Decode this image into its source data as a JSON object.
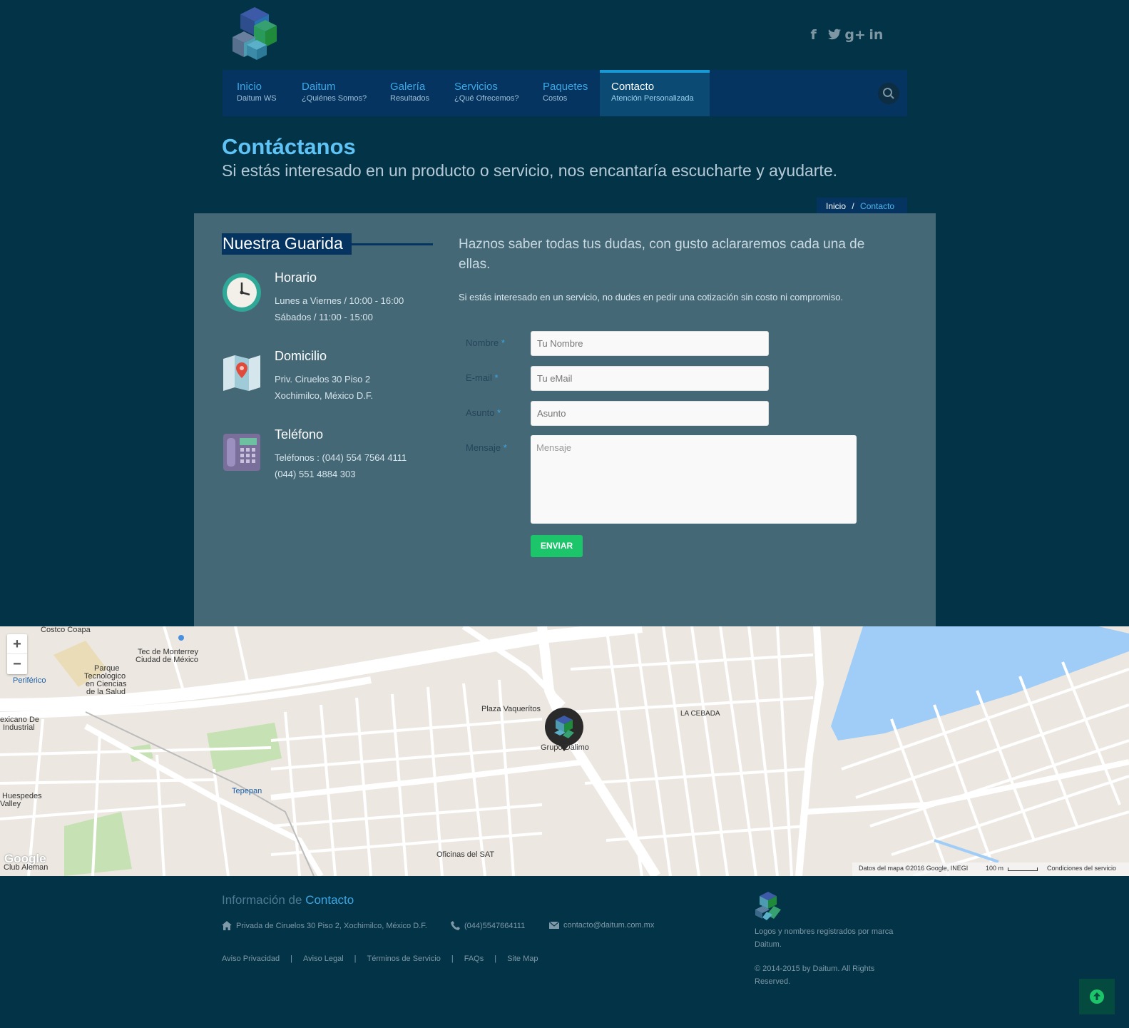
{
  "social": {
    "facebook": "f",
    "twitter": "t",
    "google": "g+",
    "linkedin": "in"
  },
  "nav": [
    {
      "title": "Inicio",
      "sub": "Daitum WS"
    },
    {
      "title": "Daitum",
      "sub": "¿Quiénes Somos?"
    },
    {
      "title": "Galería",
      "sub": "Resultados"
    },
    {
      "title": "Servicios",
      "sub": "¿Qué Ofrecemos?"
    },
    {
      "title": "Paquetes",
      "sub": "Costos"
    },
    {
      "title": "Contacto",
      "sub": "Atención Personalizada"
    }
  ],
  "page": {
    "title": "Contáctanos",
    "subtitle": "Si estás interesado en un producto o servicio, nos encantaría escucharte y ayudarte."
  },
  "breadcrumb": {
    "home": "Inicio",
    "sep": "/",
    "current": "Contacto"
  },
  "guarida": {
    "title": "Nuestra Guarida"
  },
  "info": {
    "horario": {
      "title": "Horario",
      "line1": "Lunes a Viernes / 10:00 - 16:00",
      "line2": "Sábados / 11:00 - 15:00"
    },
    "domicilio": {
      "title": "Domicilio",
      "line1": "Priv. Ciruelos 30 Piso 2",
      "line2": "Xochimilco, México D.F."
    },
    "telefono": {
      "title": "Teléfono",
      "line1": "Teléfonos : (044) 554 7564 4111",
      "line2": "(044) 551 4884 303"
    }
  },
  "form": {
    "lead": "Haznos saber todas tus dudas, con gusto aclararemos cada una de ellas.",
    "lead2": "Si estás interesado en un servicio, no dudes en pedir una cotización sin costo ni compromiso.",
    "required_mark": "*",
    "nombre": {
      "label": "Nombre",
      "placeholder": "Tu Nombre"
    },
    "email": {
      "label": "E-mail",
      "placeholder": "Tu eMail"
    },
    "asunto": {
      "label": "Asunto",
      "placeholder": "Asunto"
    },
    "mensaje": {
      "label": "Mensaje",
      "placeholder": "Mensaje"
    },
    "submit": "ENVIAR"
  },
  "map": {
    "zoom_in": "+",
    "zoom_out": "−",
    "labels": {
      "costco": "Costco Coapa",
      "tec": "Tec de Monterrey",
      "tec2": "Ciudad de México",
      "parque": "Parque",
      "parque2": "Tecnologico",
      "parque3": "en Ciencias",
      "parque4": "de la Salud",
      "periferico": "Periférico",
      "mexicano": "exicano De",
      "mexicano2": "Industrial",
      "huespedes": "Huespedes",
      "valley": "Valley",
      "tepepan": "Tepepan",
      "plaza": "Plaza Vaquerítos",
      "grupo": "Grupo Dalimo",
      "cebada": "LA CEBADA",
      "sat": "Oficinas del SAT",
      "club": "Club Aleman",
      "google": "Google"
    },
    "attribution": "Datos del mapa ©2016 Google, INEGI",
    "scale": "100 m",
    "terms": "Condiciones del servicio"
  },
  "footer": {
    "title_a": "Información de",
    "title_b": "Contacto",
    "address": "Privada de Ciruelos 30 Piso 2, Xochimilco, México D.F.",
    "phone": "(044)5547664111",
    "email": "contacto@daitum.com.mx",
    "links": [
      "Aviso Privacidad",
      "Aviso Legal",
      "Términos de Servicio",
      "FAQs",
      "Site Map"
    ],
    "link_sep": "|",
    "trademark": "Logos y nombres registrados por marca Daitum.",
    "copyright": "© 2014-2015 by Daitum. All Rights Reserved."
  }
}
